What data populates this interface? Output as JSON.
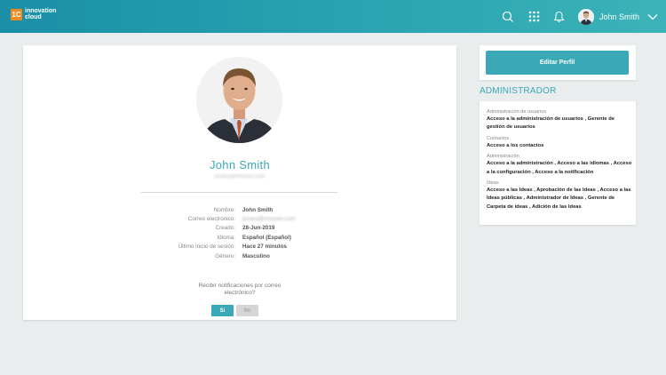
{
  "header": {
    "logo_badge": "1C",
    "logo_line1": "innovation",
    "logo_line2": "cloud",
    "user_name": "John Smith",
    "icons": [
      "search-icon",
      "apps-grid-icon",
      "bell-icon",
      "chevron-down-icon"
    ]
  },
  "profile": {
    "name": "John Smith",
    "email_obscured": "jsvans@mnsces.com",
    "details": [
      {
        "label": "Nombre:",
        "value": "John Smith",
        "blurred": false
      },
      {
        "label": "Correo electrónico:",
        "value": "jsvans@mnsces.com",
        "blurred": true
      },
      {
        "label": "Creado:",
        "value": "28-Jun-2019",
        "blurred": false
      },
      {
        "label": "Idioma:",
        "value": "Español (Español)",
        "blurred": false
      },
      {
        "label": "Último inicio de sesión:",
        "value": "Hace 27 minutos",
        "blurred": false
      },
      {
        "label": "Género:",
        "value": "Masculino",
        "blurred": false
      }
    ],
    "notify_question": "Recibir notificaciones por correo electrónico?",
    "yes_label": "Sí",
    "no_label": "No"
  },
  "sidebar": {
    "edit_label": "Editar Perfil",
    "admin_heading": "ADMINISTRADOR",
    "permissions": [
      {
        "category": "Administración de usuarios",
        "items": "Acceso a la administración de usuarios , Gerente de gestión de usuarios"
      },
      {
        "category": "Contactos",
        "items": "Acceso a los contactos"
      },
      {
        "category": "Administración",
        "items": "Acceso a la administración , Acceso a las idiomas , Acceso a la configuración , Acceso a la notificación"
      },
      {
        "category": "Ideas",
        "items": "Acceso a las Ideas , Aprobación de las Ideas , Acceso a las Ideas públicas , Administrador de Ideas , Gerente de Carpeta de ideas , Adición de las Ideas"
      }
    ]
  },
  "colors": {
    "accent": "#3aa8b6",
    "topbar_start": "#1a8fa6",
    "topbar_end": "#3cb3b8",
    "logo_orange": "#f08a1f",
    "background": "#e9edee"
  }
}
